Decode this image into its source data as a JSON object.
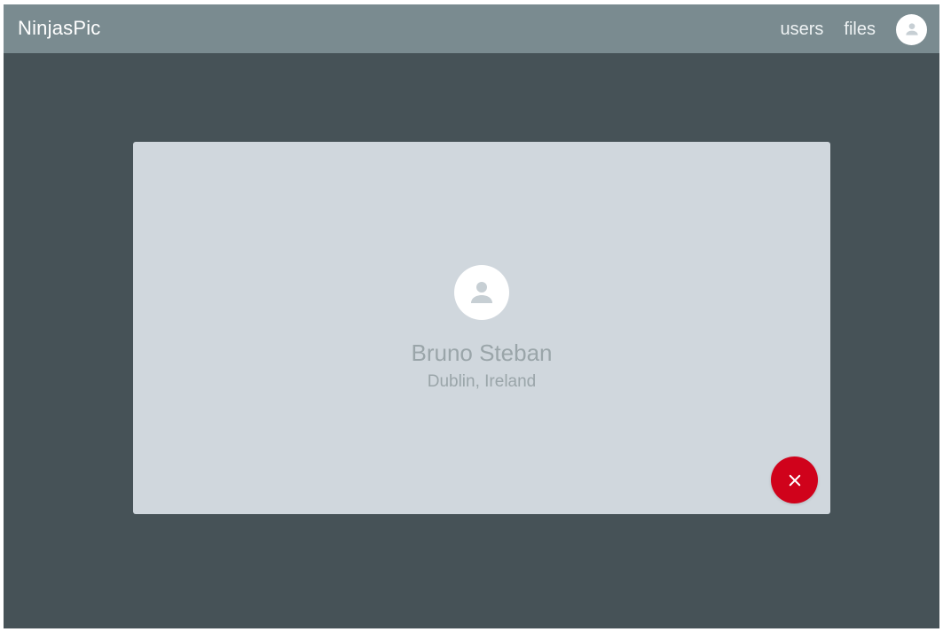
{
  "header": {
    "brand": "NinjasPic",
    "nav": [
      {
        "label": "users"
      },
      {
        "label": "files"
      }
    ],
    "avatar_icon": "person-icon"
  },
  "profile": {
    "name": "Bruno Steban",
    "location": "Dublin, Ireland",
    "avatar_icon": "person-icon",
    "close_icon": "close-icon"
  },
  "colors": {
    "topbar": "#7a8b90",
    "background": "#465257",
    "card": "#d0d7dd",
    "accent_close": "#d0021b",
    "muted_text": "#9aa5a9"
  }
}
